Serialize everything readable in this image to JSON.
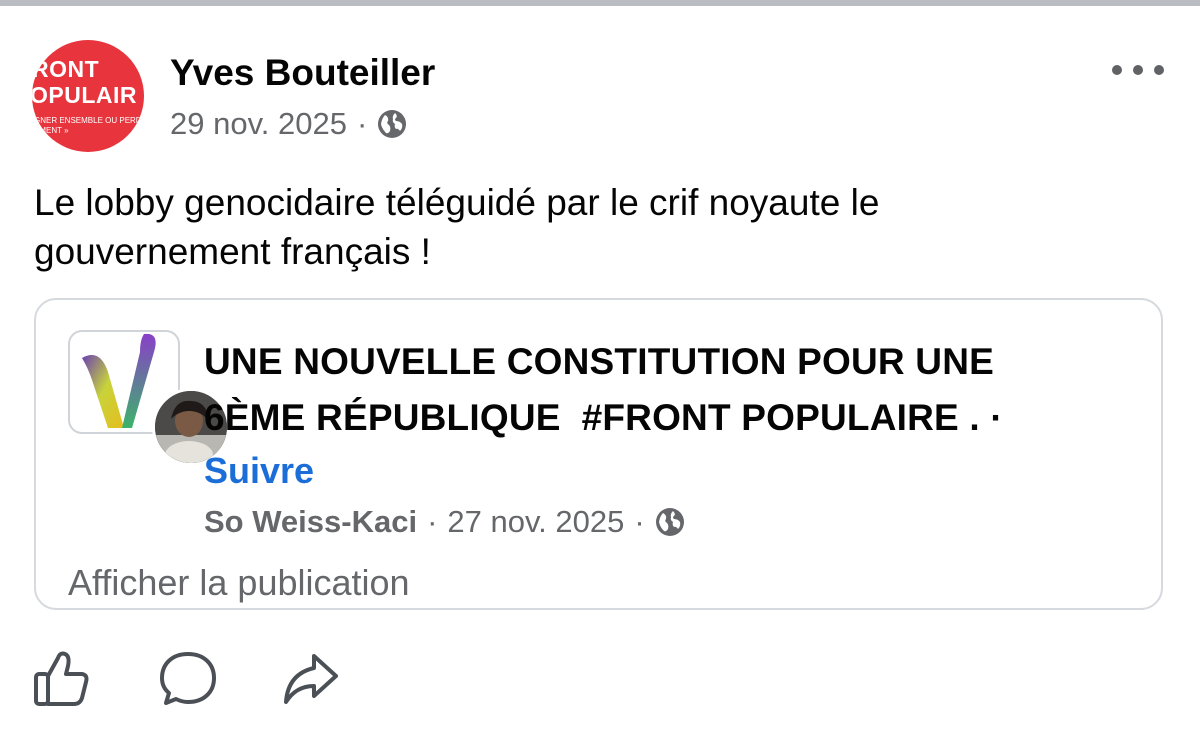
{
  "post": {
    "avatar": {
      "line1": "RONT",
      "line2": "OPULAIR",
      "line3a": "GNER ENSEMBLE OU PERD",
      "line3b": "ÉMENT »",
      "color": "#e8343c"
    },
    "author": "Yves Bouteiller",
    "date": "29 nov. 2025",
    "separator": "·",
    "audience_icon": "globe-icon",
    "more_icon": "more-options-icon",
    "text_line1": "Le lobby genocidaire téléguidé par le crif noyaute le",
    "text_line2": "gouvernement français !"
  },
  "shared": {
    "title_line1": "UNE NOUVELLE CONSTITUTION POUR UNE",
    "title_line2": "6ÈME RÉPUBLIQUE  #FRONT POPULAIRE . ·",
    "follow_label": "Suivre",
    "author": "So Weiss-Kaci",
    "separator": "·",
    "date": "27 nov. 2025",
    "separator2": "·",
    "view_label": "Afficher la publication"
  },
  "actions": {
    "like_icon": "thumbs-up-icon",
    "comment_icon": "comment-icon",
    "share_icon": "share-icon"
  },
  "colors": {
    "link": "#1b6dd8",
    "secondary_text": "#65676b",
    "border": "#d6d9dd"
  }
}
